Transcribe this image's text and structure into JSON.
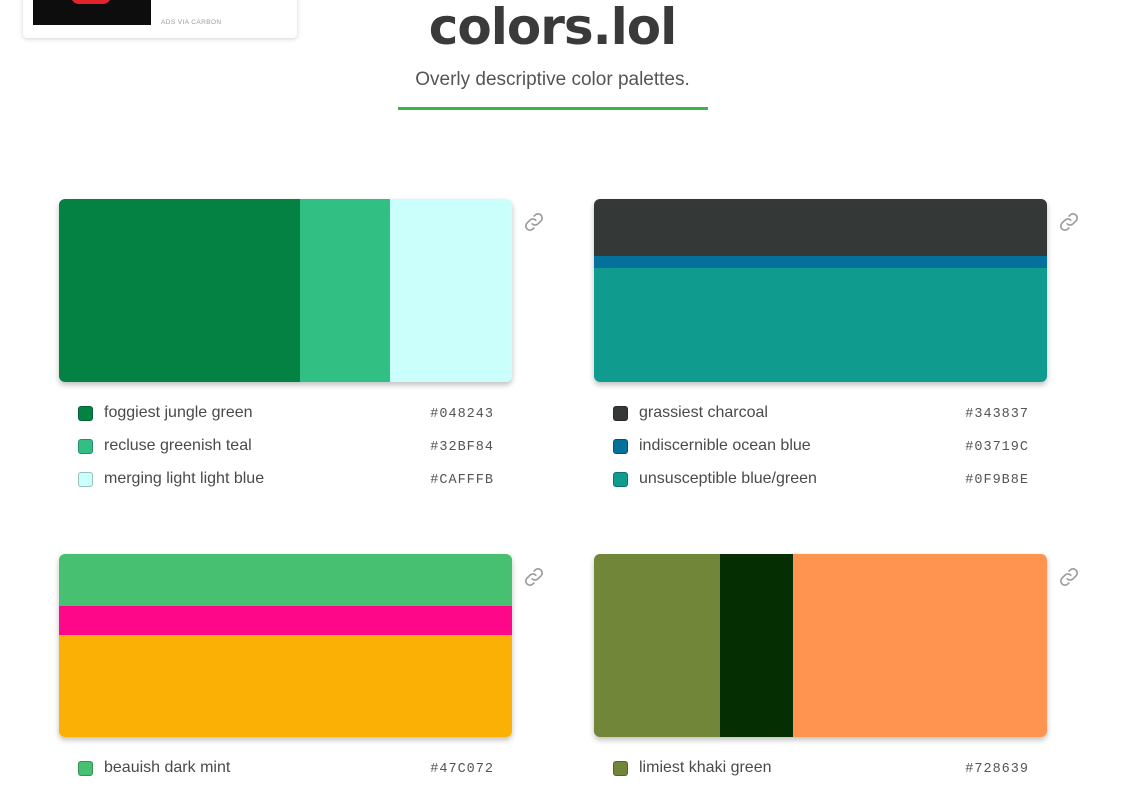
{
  "ad": {
    "via_label": "ADS VIA CARBON"
  },
  "site": {
    "title": "colors.lol",
    "tagline": "Overly descriptive color palettes."
  },
  "accent": "#3bb54a",
  "palettes": [
    {
      "layout": "columns",
      "bands": [
        {
          "hex": "#048243",
          "weight": 241
        },
        {
          "hex": "#32BF84",
          "weight": 90
        },
        {
          "hex": "#CAFFFB",
          "weight": 122
        }
      ],
      "colors": [
        {
          "name": "foggiest jungle green",
          "hex": "#048243"
        },
        {
          "name": "recluse greenish teal",
          "hex": "#32BF84"
        },
        {
          "name": "merging light light blue",
          "hex": "#CAFFFB"
        }
      ]
    },
    {
      "layout": "rows",
      "bands": [
        {
          "hex": "#343837",
          "weight": 57
        },
        {
          "hex": "#03719C",
          "weight": 12
        },
        {
          "hex": "#0F9B8E",
          "weight": 114
        }
      ],
      "colors": [
        {
          "name": "grassiest charcoal",
          "hex": "#343837"
        },
        {
          "name": "indiscernible ocean blue",
          "hex": "#03719C"
        },
        {
          "name": "unsusceptible blue/green",
          "hex": "#0F9B8E"
        }
      ]
    },
    {
      "layout": "rows",
      "bands": [
        {
          "hex": "#47C072",
          "weight": 52
        },
        {
          "hex": "#FF0789",
          "weight": 29
        },
        {
          "hex": "#FBB005",
          "weight": 102
        }
      ],
      "colors": [
        {
          "name": "beauish dark mint",
          "hex": "#47C072"
        }
      ]
    },
    {
      "layout": "columns",
      "bands": [
        {
          "hex": "#728639",
          "weight": 126
        },
        {
          "hex": "#062E03",
          "weight": 73
        },
        {
          "hex": "#FF9450",
          "weight": 254
        }
      ],
      "colors": [
        {
          "name": "limiest khaki green",
          "hex": "#728639"
        }
      ]
    }
  ]
}
